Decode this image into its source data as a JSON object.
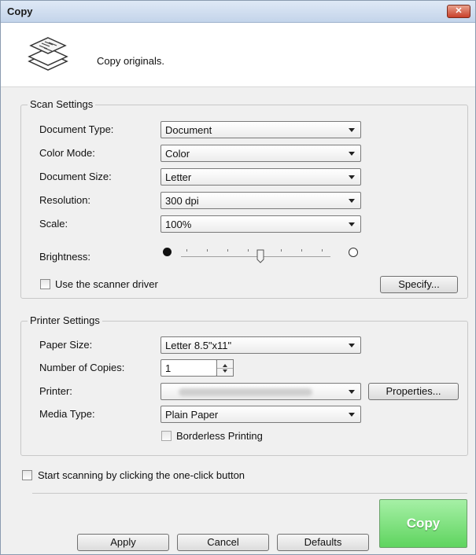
{
  "window": {
    "title": "Copy",
    "close_label": "✕"
  },
  "header": {
    "description": "Copy originals."
  },
  "scan_settings": {
    "title": "Scan Settings",
    "document_type": {
      "label": "Document Type:",
      "value": "Document"
    },
    "color_mode": {
      "label": "Color Mode:",
      "value": "Color"
    },
    "document_size": {
      "label": "Document Size:",
      "value": "Letter"
    },
    "resolution": {
      "label": "Resolution:",
      "value": "300 dpi"
    },
    "scale": {
      "label": "Scale:",
      "value": "100%"
    },
    "brightness": {
      "label": "Brightness:",
      "level": 0.5
    },
    "use_scanner_driver": {
      "label": "Use the scanner driver",
      "checked": false
    },
    "specify_label": "Specify..."
  },
  "printer_settings": {
    "title": "Printer Settings",
    "paper_size": {
      "label": "Paper Size:",
      "value": "Letter 8.5\"x11\""
    },
    "number_of_copies": {
      "label": "Number of Copies:",
      "value": "1"
    },
    "printer": {
      "label": "Printer:"
    },
    "properties_label": "Properties...",
    "media_type": {
      "label": "Media Type:",
      "value": "Plain Paper"
    },
    "borderless": {
      "label": "Borderless Printing",
      "checked": false
    }
  },
  "one_click": {
    "label": "Start scanning by clicking the one-click button",
    "checked": false
  },
  "footer": {
    "apply_label": "Apply",
    "cancel_label": "Cancel",
    "defaults_label": "Defaults",
    "copy_label": "Copy"
  },
  "colors": {
    "copy_button": "#6fdc6f",
    "title_bar": "#c3d4ea"
  }
}
